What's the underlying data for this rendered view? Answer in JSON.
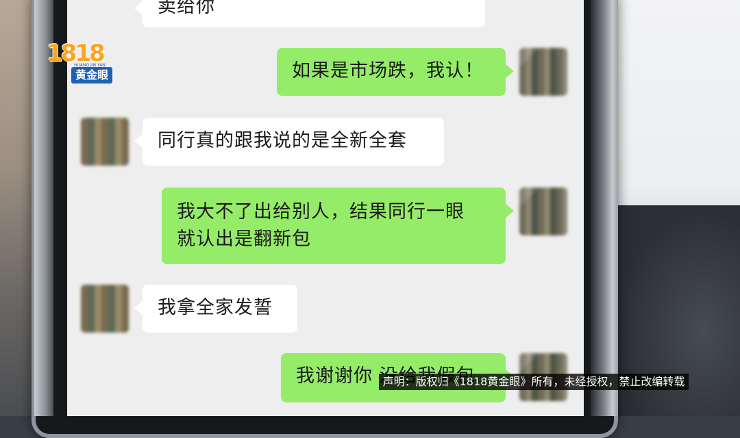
{
  "chat": {
    "messages": [
      {
        "side": "in",
        "text": "卖给你"
      },
      {
        "side": "out",
        "text": "如果是市场跌，我认！"
      },
      {
        "side": "in",
        "text": "同行真的跟我说的是全新全套"
      },
      {
        "side": "out",
        "line1": "我大不了出给别人，结果同行一眼",
        "line2": "就认出是翻新包"
      },
      {
        "side": "in",
        "text": "我拿全家发誓"
      },
      {
        "side": "out",
        "text": "我谢谢你 没给我假包"
      }
    ]
  },
  "overlay": {
    "logo_number": "1818",
    "logo_badge": "黄金眼",
    "logo_small": "HUANG JIN YAN",
    "disclaimer": "声明：版权归《1818黄金眼》所有，未经授权，禁止改编转载"
  },
  "colors": {
    "incoming_bubble": "#ffffff",
    "outgoing_bubble": "#95ec69",
    "chat_background": "#eeeeee",
    "logo_orange": "#f5a623",
    "logo_blue": "#1f5fb8"
  }
}
